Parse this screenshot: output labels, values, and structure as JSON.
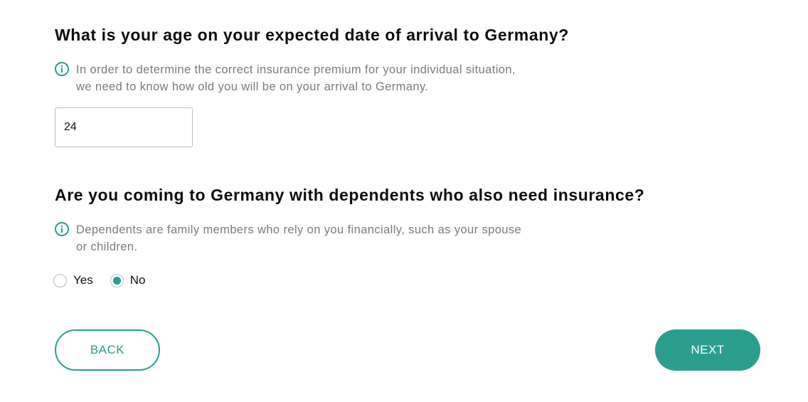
{
  "age_question": {
    "title": "What is your age on your expected date of arrival to Germany?",
    "info": "In order to determine the correct insurance premium for your individual situation, we need to know how old you will be on your arrival to Germany.",
    "age_value": "24"
  },
  "dependents_question": {
    "title": "Are you coming to Germany with dependents who also need insurance?",
    "info": "Dependents are family members who rely on you financially, such as your spouse or children.",
    "options": [
      {
        "label": "Yes",
        "selected": false
      },
      {
        "label": "No",
        "selected": true
      }
    ]
  },
  "navigation": {
    "back_label": "BACK",
    "next_label": "NEXT"
  },
  "colors": {
    "accent": "#2a9d8f",
    "heading": "#0d0d0d",
    "info_text": "#7b7b7b",
    "input_border": "#bdbdbd"
  },
  "icons": [
    "info-icon",
    "info-icon"
  ]
}
